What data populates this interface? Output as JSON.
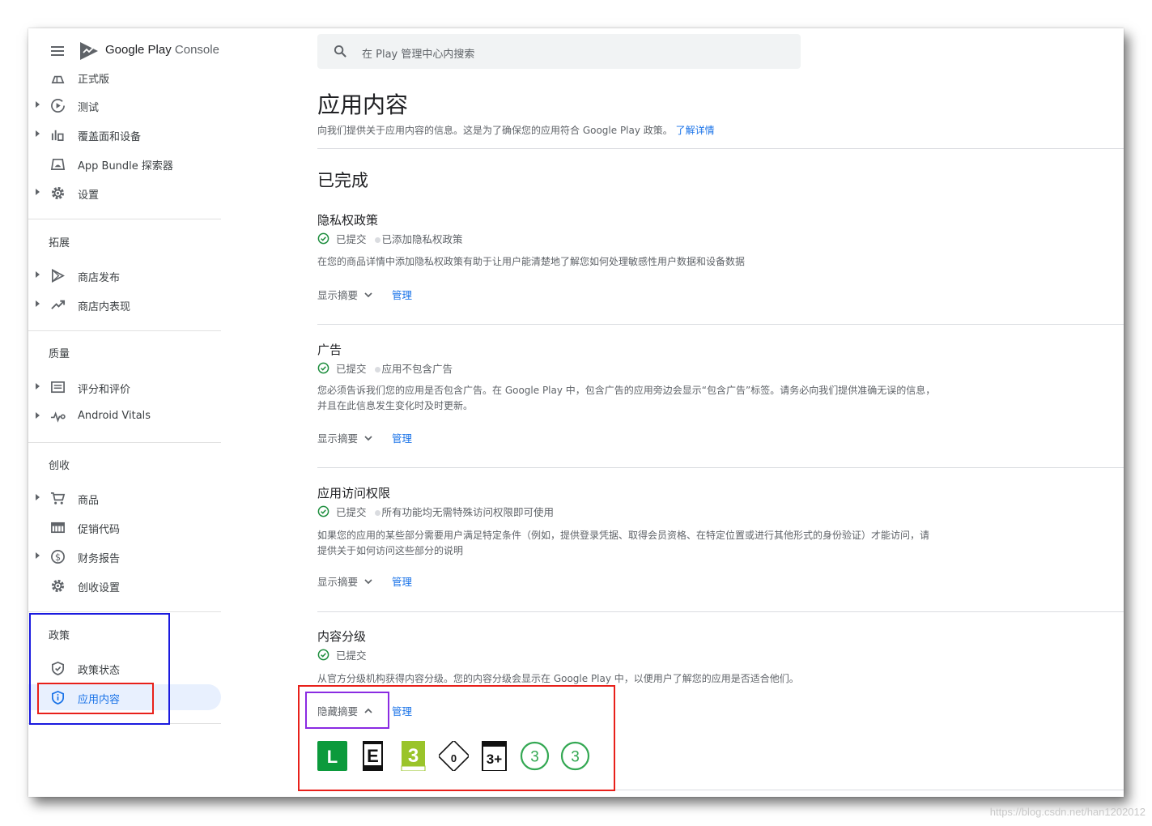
{
  "brand": {
    "google_play": "Google Play",
    "console": "Console"
  },
  "search": {
    "placeholder": "在 Play 管理中心内搜索"
  },
  "sidebar": {
    "items_top": [
      {
        "label": "正式版",
        "icon": "release-icon",
        "caret": false
      },
      {
        "label": "测试",
        "icon": "play-circle-icon",
        "caret": true
      },
      {
        "label": "覆盖面和设备",
        "icon": "bar-chart-icon",
        "caret": true
      },
      {
        "label": "App Bundle 探索器",
        "icon": "android-box-icon",
        "caret": false
      },
      {
        "label": "设置",
        "icon": "gear-icon",
        "caret": true
      }
    ],
    "sections": {
      "grow": {
        "title": "拓展",
        "items": [
          {
            "label": "商店发布",
            "icon": "play-store-icon",
            "caret": true
          },
          {
            "label": "商店内表现",
            "icon": "trending-up-icon",
            "caret": true
          }
        ]
      },
      "quality": {
        "title": "质量",
        "items": [
          {
            "label": "评分和评价",
            "icon": "reviews-icon",
            "caret": true
          },
          {
            "label": "Android Vitals",
            "icon": "vitals-icon",
            "caret": true
          }
        ]
      },
      "monetize": {
        "title": "创收",
        "items": [
          {
            "label": "商品",
            "icon": "cart-icon",
            "caret": true
          },
          {
            "label": "促销代码",
            "icon": "promo-code-icon",
            "caret": false
          },
          {
            "label": "财务报告",
            "icon": "dollar-icon",
            "caret": true
          },
          {
            "label": "创收设置",
            "icon": "gear-icon",
            "caret": false
          }
        ]
      },
      "policy": {
        "title": "政策",
        "items": [
          {
            "label": "政策状态",
            "icon": "shield-check-icon",
            "caret": false
          },
          {
            "label": "应用内容",
            "icon": "shield-info-icon",
            "caret": false,
            "active": true
          }
        ]
      }
    }
  },
  "main": {
    "title": "应用内容",
    "desc": "向我们提供关于应用内容的信息。这是为了确保您的应用符合 Google Play 政策。",
    "learn_more": "了解详情",
    "done_title": "已完成",
    "submitted": "已提交",
    "show_summary": "显示摘要",
    "hide_summary": "隐藏摘要",
    "manage": "管理",
    "cards": [
      {
        "title": "隐私权政策",
        "note": "已添加隐私权政策",
        "desc": "在您的商品详情中添加隐私权政策有助于让用户能清楚地了解您如何处理敏感性用户数据和设备数据"
      },
      {
        "title": "广告",
        "note": "应用不包含广告",
        "desc1": "您必须告诉我们您的应用是否包含广告。在 Google Play 中，包含广告的应用旁边会显示“包含广告”标签。请务必向我们提供准确无误的信息，",
        "desc2": "并且在此信息发生变化时及时更新。"
      },
      {
        "title": "应用访问权限",
        "note": "所有功能均无需特殊访问权限即可使用",
        "desc1": "如果您的应用的某些部分需要用户满足特定条件（例如，提供登录凭据、取得会员资格、在特定位置或进行其他形式的身份验证）才能访问，请",
        "desc2": "提供关于如何访问这些部分的说明"
      },
      {
        "title": "内容分级",
        "desc": "从官方分级机构获得内容分级。您的内容分级会显示在 Google Play 中，以便用户了解您的应用是否适合他们。"
      }
    ],
    "ratings": {
      "classind": "L",
      "esrb": "E",
      "pegi": "3",
      "usk": "0",
      "iarc": "3+",
      "generic1": "3",
      "generic2": "3"
    }
  },
  "colors": {
    "accent": "#1a73e8",
    "success": "#1e8e3e",
    "annot_red": "#e8201a",
    "annot_blue": "#1a1adf",
    "annot_purple": "#8a2be2"
  },
  "watermark": "https://blog.csdn.net/han1202012"
}
